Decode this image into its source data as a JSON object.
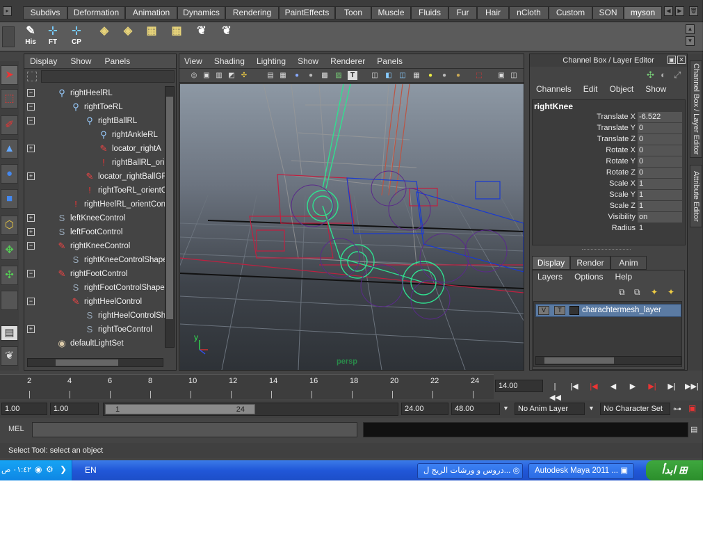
{
  "shelf": {
    "tabs": [
      "Subdivs",
      "Deformation",
      "Animation",
      "Dynamics",
      "Rendering",
      "PaintEffects",
      "Toon",
      "Muscle",
      "Fluids",
      "Fur",
      "Hair",
      "nCloth",
      "Custom",
      "SON",
      "myson"
    ],
    "active_tab": "myson",
    "buttons": [
      "His",
      "FT",
      "CP"
    ]
  },
  "outliner": {
    "menus": [
      "Display",
      "Show",
      "Panels"
    ],
    "rows": [
      {
        "label": "rightHeelRL",
        "expander": "−",
        "icon": "joint-icon"
      },
      {
        "label": "rightToeRL",
        "expander": "−",
        "icon": "joint-icon"
      },
      {
        "label": "rightBallRL",
        "expander": "−",
        "icon": "joint-icon"
      },
      {
        "label": "rightAnkleRL",
        "expander": "",
        "icon": "joint-icon"
      },
      {
        "label": "locator_rightA",
        "expander": "+",
        "icon": "locator-icon"
      },
      {
        "label": "rightBallRL_ori",
        "expander": "",
        "icon": "constraint-icon"
      },
      {
        "label": "locator_rightBallGR",
        "expander": "+",
        "icon": "locator-icon"
      },
      {
        "label": "rightToeRL_orientC",
        "expander": "",
        "icon": "constraint-icon"
      },
      {
        "label": "rightHeelRL_orientCon",
        "expander": "",
        "icon": "constraint-icon"
      },
      {
        "label": "leftKneeControl",
        "expander": "+",
        "icon": "curve-icon"
      },
      {
        "label": "leftFootControl",
        "expander": "+",
        "icon": "curve-icon"
      },
      {
        "label": "rightKneeControl",
        "expander": "−",
        "icon": "locator-icon"
      },
      {
        "label": "rightKneeControlShape",
        "expander": "",
        "icon": "curve-icon"
      },
      {
        "label": "rightFootControl",
        "expander": "−",
        "icon": "locator-icon"
      },
      {
        "label": "rightFootControlShape",
        "expander": "",
        "icon": "curve-icon"
      },
      {
        "label": "rightHeelControl",
        "expander": "−",
        "icon": "locator-icon"
      },
      {
        "label": "rightHeelControlSh",
        "expander": "",
        "icon": "curve-icon"
      },
      {
        "label": "rightToeControl",
        "expander": "+",
        "icon": "curve-icon"
      },
      {
        "label": "defaultLightSet",
        "expander": "",
        "icon": "lightset-icon"
      }
    ]
  },
  "viewport": {
    "menus": [
      "View",
      "Shading",
      "Lighting",
      "Show",
      "Renderer",
      "Panels"
    ],
    "camera_label": "persp",
    "axis_label": "y"
  },
  "channel_box": {
    "title": "Channel Box / Layer Editor",
    "menus": [
      "Channels",
      "Edit",
      "Object",
      "Show"
    ],
    "node_name": "rightKnee",
    "attributes": [
      {
        "name": "Translate X",
        "value": "-6.522"
      },
      {
        "name": "Translate Y",
        "value": "0"
      },
      {
        "name": "Translate Z",
        "value": "0"
      },
      {
        "name": "Rotate X",
        "value": "0"
      },
      {
        "name": "Rotate Y",
        "value": "0"
      },
      {
        "name": "Rotate Z",
        "value": "0"
      },
      {
        "name": "Scale X",
        "value": "1"
      },
      {
        "name": "Scale Y",
        "value": "1"
      },
      {
        "name": "Scale Z",
        "value": "1"
      },
      {
        "name": "Visibility",
        "value": "on"
      },
      {
        "name": "Radius",
        "value": "1"
      }
    ],
    "layer_tabs": [
      "Display",
      "Render",
      "Anim"
    ],
    "active_layer_tab": "Display",
    "layer_menus": [
      "Layers",
      "Options",
      "Help"
    ],
    "layer": {
      "v": "V",
      "t": "T",
      "name": "charachtermesh_layer"
    }
  },
  "side_tabs": [
    "Channel Box / Layer Editor",
    "Attribute Editor"
  ],
  "timeline": {
    "ticks": [
      "2",
      "4",
      "6",
      "8",
      "10",
      "12",
      "14",
      "16",
      "18",
      "20",
      "22",
      "24"
    ],
    "current_frame": "14.00",
    "start": "1.00",
    "start2": "1.00",
    "range_min": "1",
    "range_max": "24",
    "end": "24.00",
    "end2": "48.00",
    "anim_layer": "No Anim Layer",
    "character_set": "No Character Set"
  },
  "command": {
    "label": "MEL"
  },
  "help_line": "Select Tool: select an object",
  "taskbar": {
    "start": "ابدأ",
    "tasks": [
      "Autodesk Maya 2011 ...",
      "دروس و ورشات الريج ل..."
    ],
    "language": "EN",
    "clock": "٠١:٤٢ ص"
  },
  "colors": {
    "maya_bg": "#444444",
    "accent": "#5b7ba3",
    "taskbar": "#2157d8"
  }
}
